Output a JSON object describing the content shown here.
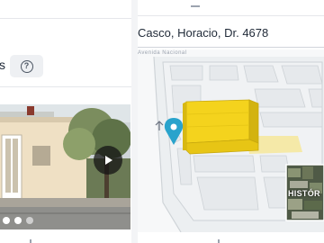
{
  "panel": {
    "section_title": "s",
    "help_icon": "question-circle-icon"
  },
  "streetview": {
    "play_icon": "play-icon",
    "slide_count": 3,
    "active_slide": 1
  },
  "location": {
    "address": "Casco, Horacio, Dr. 4678",
    "road_label": "Avenida Nacional"
  },
  "map": {
    "history_label": "HISTÓR",
    "marker_icon": "map-pin-icon",
    "building_color": "#f2d21a",
    "lot_color": "#f5e9a8",
    "marker_color": "#29a3cc"
  }
}
